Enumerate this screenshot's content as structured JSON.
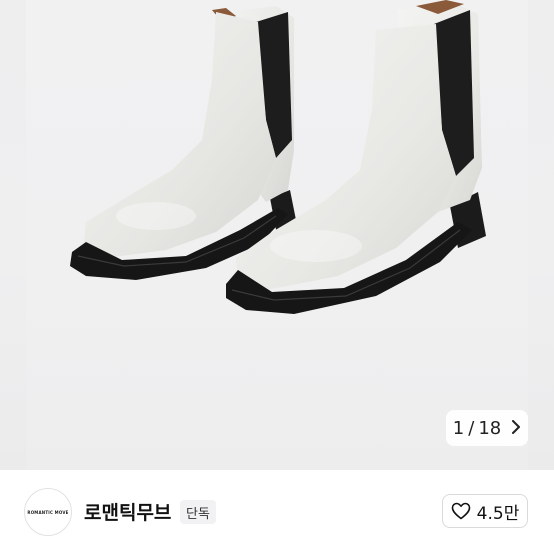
{
  "gallery": {
    "counter_current": "1",
    "counter_separator": "/",
    "counter_total": "18",
    "next_icon": "chevron-right-icon"
  },
  "brand": {
    "logo_text": "ROMANTIC MOVE",
    "name": "로맨틱무브",
    "badge": "단독"
  },
  "like": {
    "icon": "heart-outline-icon",
    "count": "4.5만"
  },
  "colors": {
    "boot_leather": "#e9e9e6",
    "elastic_panel": "#1c1c1c",
    "sole": "#1a1a1a",
    "heel_tab": "#8a5a3a"
  }
}
